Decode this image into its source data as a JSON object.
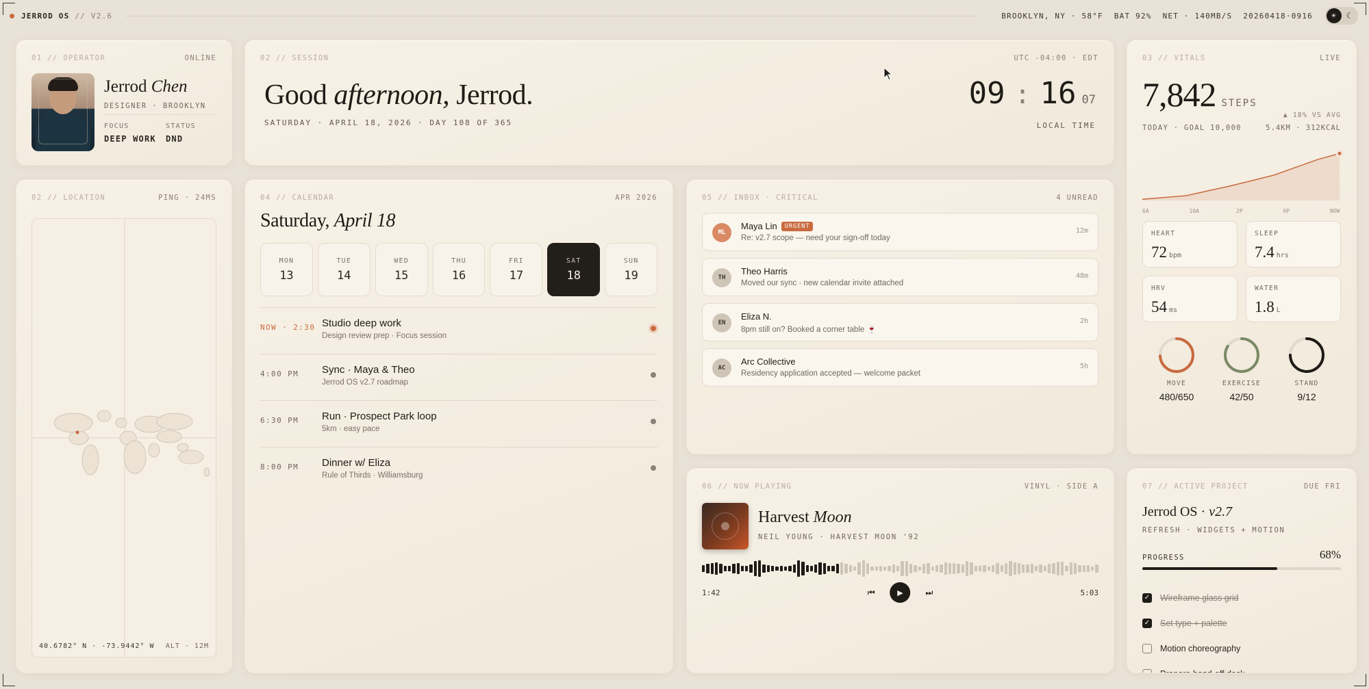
{
  "topbar": {
    "brand": "JERROD OS",
    "version": "// V2.6",
    "location": "BROOKLYN, NY · 58°F",
    "battery": "BAT 92%",
    "network": "NET · 140MB/S",
    "datecode": "20260418·0916",
    "theme_light_icon": "☀",
    "theme_dark_icon": "☾"
  },
  "operator": {
    "head_num": "01 // OPERATOR",
    "head_status": "ONLINE",
    "first": "Jerrod",
    "last": "Chen",
    "role": "DESIGNER · BROOKLYN",
    "focus_label": "FOCUS",
    "focus_value": "DEEP WORK",
    "status_label": "STATUS",
    "status_value": "DND"
  },
  "session": {
    "head_num": "02 // SESSION",
    "timezone": "UTC -04:00 · EDT",
    "greet_a": "Good ",
    "greet_b": "afternoon,",
    "greet_c": " Jerrod.",
    "date_line": "SATURDAY · APRIL 18, 2026 · DAY 108 OF 365",
    "hours": "09",
    "colon": ":",
    "minutes": "16",
    "seconds": "07",
    "local_label": "LOCAL TIME"
  },
  "location": {
    "head_num": "02 // LOCATION",
    "ping": "PING · 24MS",
    "coords": "40.6782° N · -73.9442° W",
    "alt": "ALT · 12M"
  },
  "calendar": {
    "head_num": "04 // CALENDAR",
    "month": "APR 2026",
    "title_a": "Saturday, ",
    "title_b": "April 18",
    "days": [
      {
        "name": "MON",
        "num": "13"
      },
      {
        "name": "TUE",
        "num": "14"
      },
      {
        "name": "WED",
        "num": "15"
      },
      {
        "name": "THU",
        "num": "16"
      },
      {
        "name": "FRI",
        "num": "17"
      },
      {
        "name": "SAT",
        "num": "18"
      },
      {
        "name": "SUN",
        "num": "19"
      }
    ],
    "active_day": 5,
    "events": [
      {
        "time": "NOW · 2:30",
        "title": "Studio deep work",
        "sub": "Design review prep · Focus session"
      },
      {
        "time": "4:00 PM",
        "title": "Sync · Maya & Theo",
        "sub": "Jerrod OS v2.7 roadmap"
      },
      {
        "time": "6:30 PM",
        "title": "Run · Prospect Park loop",
        "sub": "5km · easy pace"
      },
      {
        "time": "8:00 PM",
        "title": "Dinner w/ Eliza",
        "sub": "Rule of Thirds · Williamsburg"
      }
    ]
  },
  "inbox": {
    "head_num": "05 // INBOX · CRITICAL",
    "unread": "4 UNREAD",
    "messages": [
      {
        "initials": "ML",
        "name": "Maya Lin",
        "badge": "URGENT",
        "preview": "Re: v2.7 scope — need your sign-off today",
        "time": "12m"
      },
      {
        "initials": "TH",
        "name": "Theo Harris",
        "badge": "",
        "preview": "Moved our sync · new calendar invite attached",
        "time": "48m"
      },
      {
        "initials": "EN",
        "name": "Eliza N.",
        "badge": "",
        "preview": "8pm still on? Booked a corner table 🍷",
        "time": "2h"
      },
      {
        "initials": "AC",
        "name": "Arc Collective",
        "badge": "",
        "preview": "Residency application accepted — welcome packet",
        "time": "5h"
      }
    ]
  },
  "vitals": {
    "head_num": "03 // VITALS",
    "live": "LIVE",
    "steps": "7,842",
    "steps_unit": "STEPS",
    "goal_line": "TODAY · GOAL 10,000",
    "delta": "▲ 18% VS AVG",
    "dist": "5.4KM · 312KCAL",
    "chart_ticks": [
      "6A",
      "10A",
      "2P",
      "6P",
      "NOW"
    ],
    "step_curve": [
      0.02,
      0.05,
      0.08,
      0.16,
      0.24,
      0.33,
      0.42,
      0.55,
      0.68,
      0.78
    ],
    "tiles": [
      {
        "label": "HEART",
        "value": "72",
        "unit": "bpm"
      },
      {
        "label": "SLEEP",
        "value": "7.4",
        "unit": "hrs"
      },
      {
        "label": "HRV",
        "value": "54",
        "unit": "ms"
      },
      {
        "label": "WATER",
        "value": "1.8",
        "unit": "L"
      }
    ],
    "rings": [
      {
        "label": "MOVE",
        "value": "480/650",
        "fraction": 0.74,
        "color": "#c96a3f"
      },
      {
        "label": "EXERCISE",
        "value": "42/50",
        "fraction": 0.84,
        "color": "#7a8a66"
      },
      {
        "label": "STAND",
        "value": "9/12",
        "fraction": 0.75,
        "color": "#1f1b17"
      }
    ]
  },
  "now_playing": {
    "head_num": "06 // NOW PLAYING",
    "side": "VINYL · SIDE A",
    "title_a": "Harvest ",
    "title_b": "Moon",
    "artist": "NEIL YOUNG · HARVEST MOON '92",
    "elapsed": "1:42",
    "total": "5:03",
    "progress": 0.34,
    "prev_icon": "⏮",
    "play_icon": "▶",
    "next_icon": "⏭"
  },
  "project": {
    "head_num": "07 // ACTIVE PROJECT",
    "due": "DUE FRI",
    "title_a": "Jerrod OS · ",
    "title_b": "v2.7",
    "sub": "REFRESH · WIDGETS + MOTION",
    "progress_label": "PROGRESS",
    "progress_text": "68%",
    "progress": 0.68,
    "tasks": [
      {
        "label": "Wireframe glass grid",
        "done": true
      },
      {
        "label": "Set type + palette",
        "done": true
      },
      {
        "label": "Motion choreography",
        "done": false
      },
      {
        "label": "Prepare hand-off deck",
        "done": false
      }
    ]
  },
  "colors": {
    "accent": "#c96a3f",
    "ink": "#1f1b17",
    "paper": "#f4eee4"
  }
}
